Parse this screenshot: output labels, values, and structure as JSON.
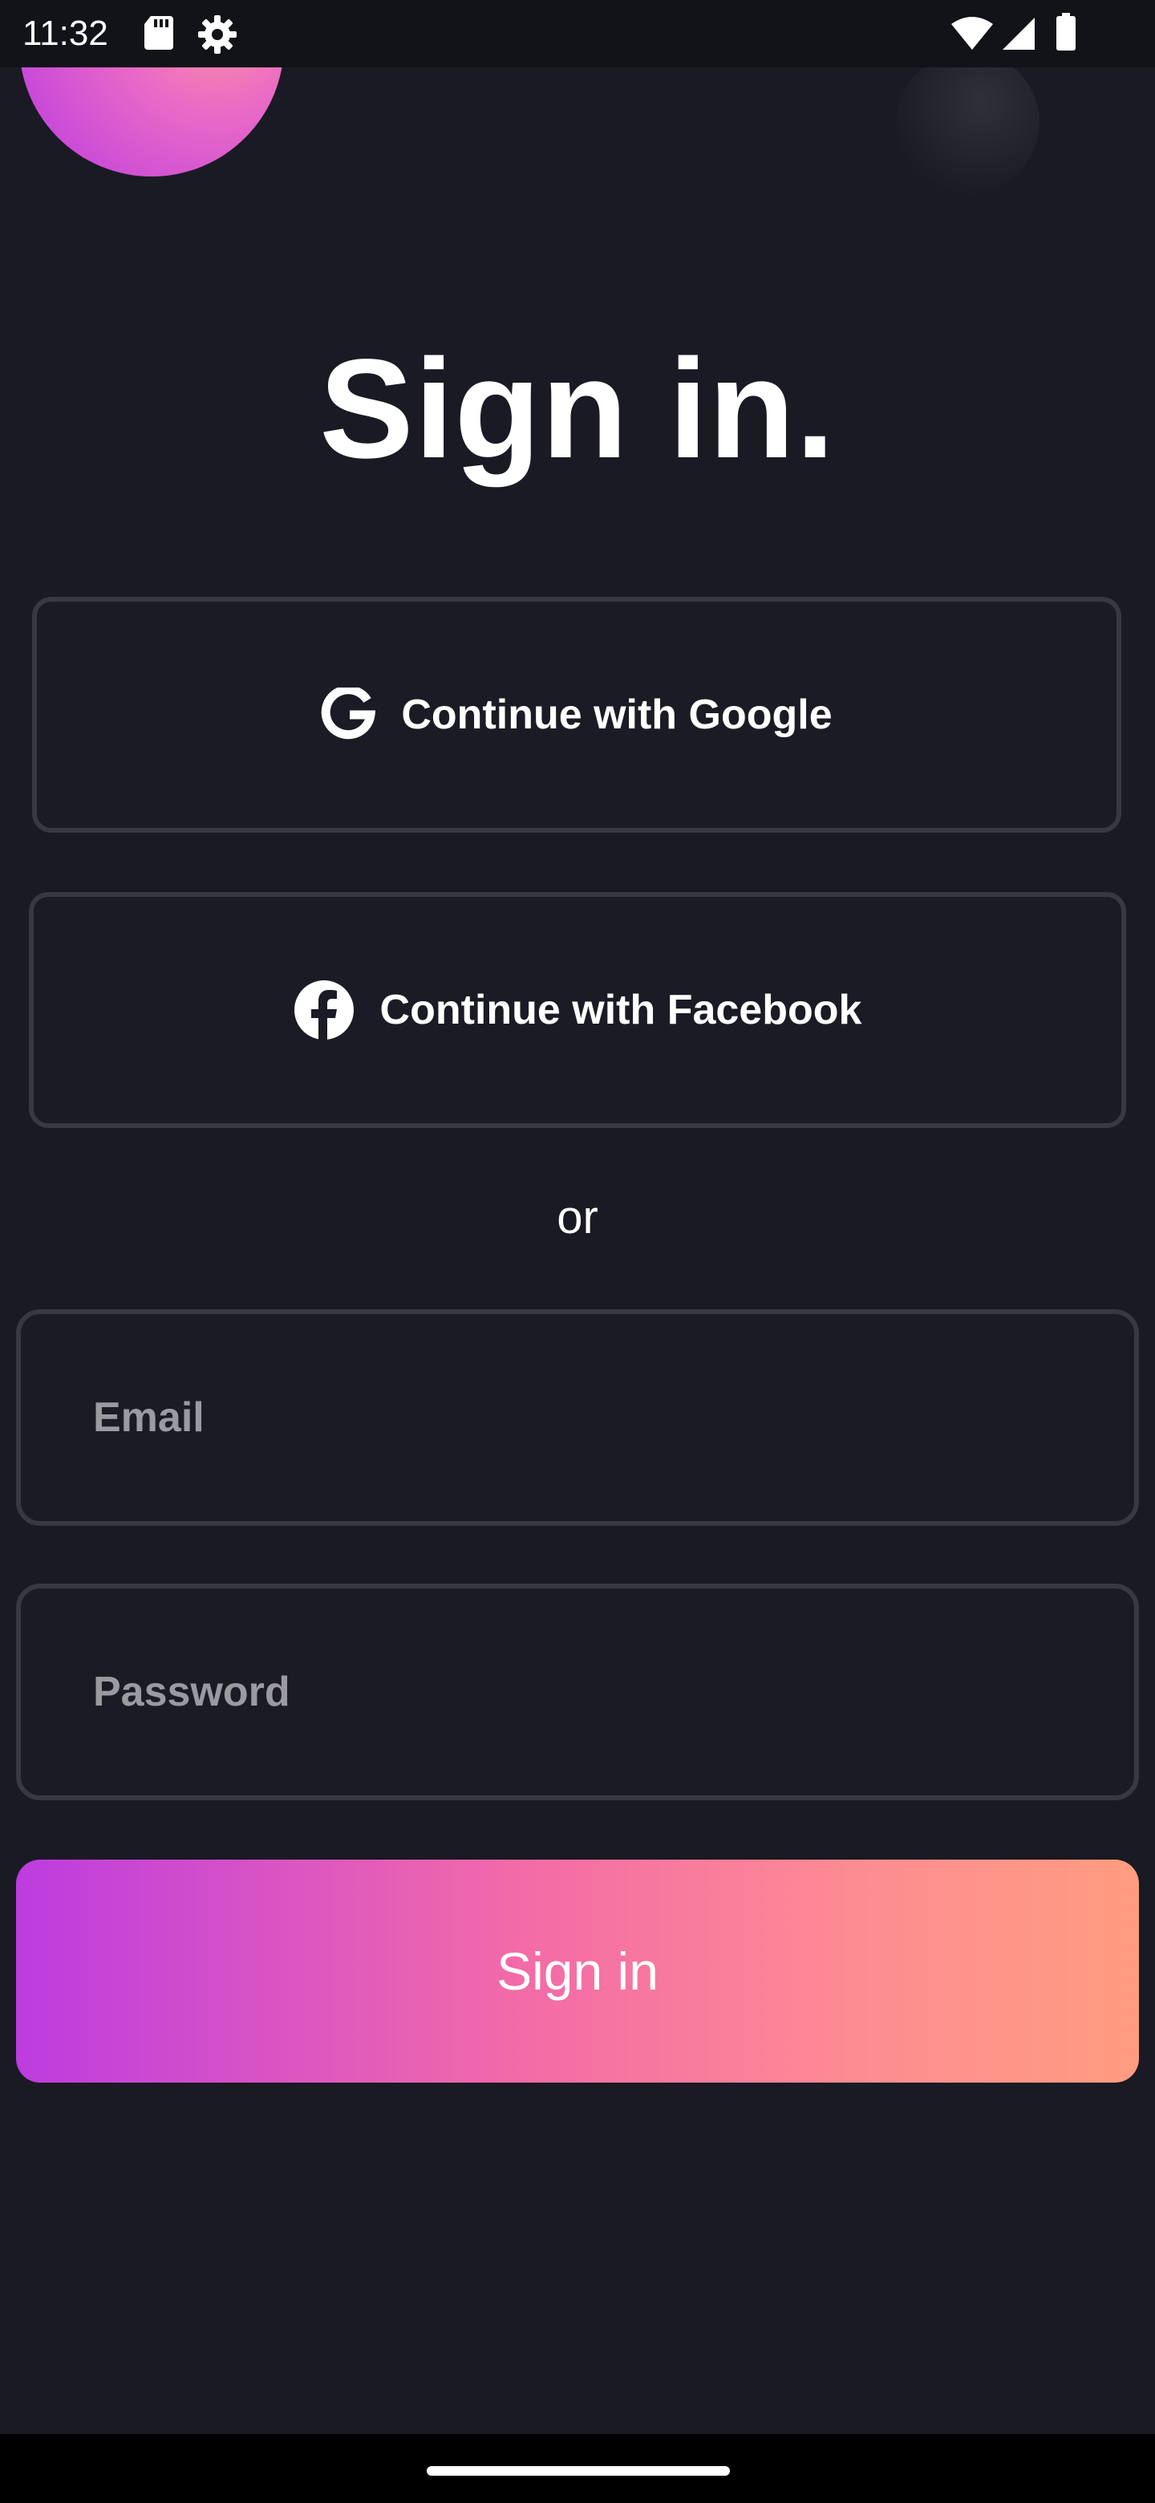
{
  "status_bar": {
    "time": "11:32",
    "icons": [
      "sd-card-icon",
      "settings-gear-icon",
      "wifi-icon",
      "cell-signal-icon",
      "battery-icon"
    ]
  },
  "title": "Sign in.",
  "buttons": {
    "google_label": "Continue with Google",
    "facebook_label": "Continue with Facebook",
    "signin_label": "Sign in"
  },
  "divider_text": "or",
  "form": {
    "email": {
      "value": "",
      "placeholder": "Email"
    },
    "password": {
      "value": "",
      "placeholder": "Password"
    }
  },
  "colors": {
    "background": "#191a23",
    "border": "#373842",
    "gradient_start": "#bd3ce0",
    "gradient_end": "#ff9d80"
  }
}
